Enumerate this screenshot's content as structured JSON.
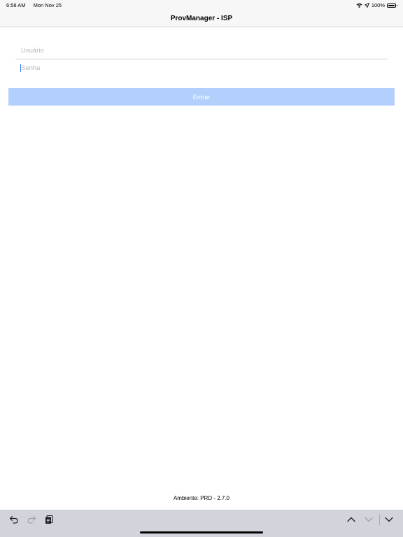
{
  "status_bar": {
    "time": "6:58 AM",
    "date": "Mon Nov 25",
    "battery": "100%",
    "icons": [
      "wifi-icon",
      "location-icon",
      "battery-icon"
    ]
  },
  "nav": {
    "title": "ProvManager - ISP"
  },
  "form": {
    "username": {
      "placeholder": "Usuário",
      "value": ""
    },
    "password": {
      "placeholder": "Senha",
      "value": ""
    },
    "submit_label": "Entrar"
  },
  "footer": {
    "environment": "Ambiente: PRD - 2.7.0"
  },
  "keyboard_toolbar": {
    "icons": [
      "undo-icon",
      "redo-icon",
      "paste-icon",
      "chevron-up-icon",
      "chevron-down-icon",
      "dismiss-keyboard-icon"
    ]
  },
  "colors": {
    "accent_disabled": "#b3cffc",
    "cursor": "#3478f6",
    "toolbar_bg": "#d1d4db"
  }
}
